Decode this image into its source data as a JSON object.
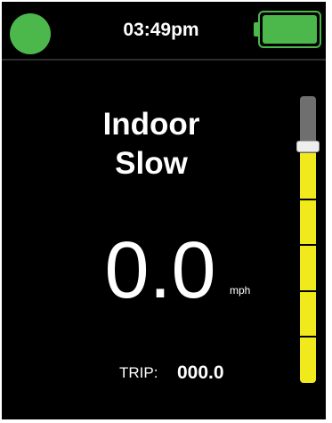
{
  "status_bar": {
    "time": "03:49pm",
    "status_indicator_color": "#4cb84c",
    "battery_level": 1.0,
    "battery_color": "#4cb84c"
  },
  "main": {
    "mode_line1": "Indoor",
    "mode_line2": "Slow",
    "speed_value": "0.0",
    "speed_unit": "mph",
    "trip_label": "TRIP:",
    "trip_value": "000.0"
  },
  "speed_slider": {
    "level": 0.8,
    "segments": 5,
    "fill_color": "#f0ea1c",
    "track_color": "#6f6f6f"
  }
}
